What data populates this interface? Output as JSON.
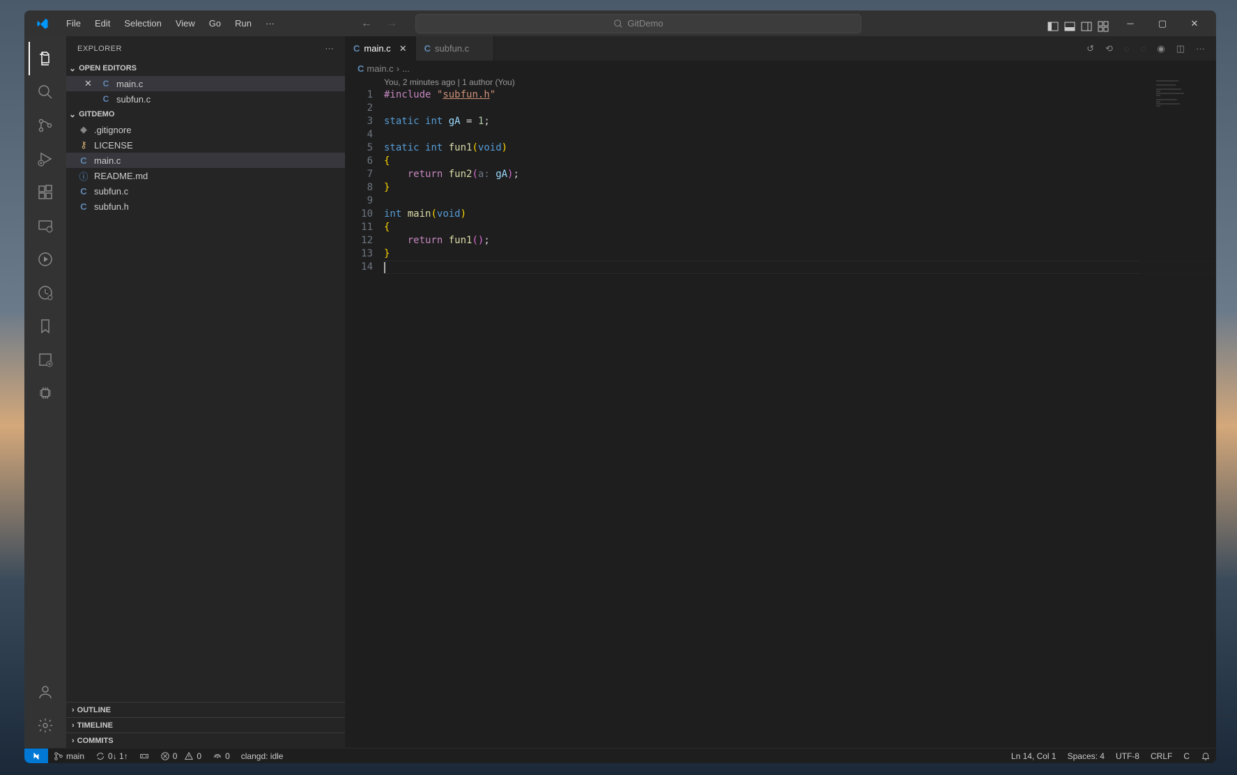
{
  "title_bar": {
    "menu": [
      "File",
      "Edit",
      "Selection",
      "View",
      "Go",
      "Run"
    ],
    "search_placeholder": "GitDemo"
  },
  "activity_bar": {
    "items": [
      "explorer",
      "search",
      "source-control",
      "run-debug",
      "extensions",
      "remote",
      "testing",
      "live-share",
      "bookmarks",
      "cmake",
      "chip"
    ],
    "bottom": [
      "accounts",
      "settings"
    ]
  },
  "sidebar": {
    "title": "EXPLORER",
    "sections": {
      "open_editors": {
        "label": "OPEN EDITORS",
        "items": [
          {
            "name": "main.c",
            "icon": "C",
            "active": true,
            "close": true
          },
          {
            "name": "subfun.c",
            "icon": "C",
            "active": false,
            "close": false
          }
        ]
      },
      "folder": {
        "label": "GITDEMO",
        "items": [
          {
            "name": ".gitignore",
            "icon": "git"
          },
          {
            "name": "LICENSE",
            "icon": "license"
          },
          {
            "name": "main.c",
            "icon": "C",
            "selected": true
          },
          {
            "name": "README.md",
            "icon": "info"
          },
          {
            "name": "subfun.c",
            "icon": "C"
          },
          {
            "name": "subfun.h",
            "icon": "C"
          }
        ]
      },
      "collapsed": [
        "OUTLINE",
        "TIMELINE",
        "COMMITS"
      ]
    }
  },
  "editor": {
    "tabs": [
      {
        "name": "main.c",
        "icon": "C",
        "active": true
      },
      {
        "name": "subfun.c",
        "icon": "C",
        "active": false
      }
    ],
    "breadcrumb": {
      "file": "main.c",
      "sep": "›",
      "rest": "..."
    },
    "codelens": "You, 2 minutes ago | 1 author (You)",
    "lines": [
      {
        "n": 1,
        "html": "<span class='kw-pp'>#include</span> <span class='str'>\"</span><span class='str-u'>subfun.h</span><span class='str'>\"</span>"
      },
      {
        "n": 2,
        "html": ""
      },
      {
        "n": 3,
        "html": "<span class='kw'>static</span> <span class='type'>int</span> <span class='var'>gA</span> <span class='punc'>=</span> <span class='num'>1</span><span class='punc'>;</span>"
      },
      {
        "n": 4,
        "html": ""
      },
      {
        "n": 5,
        "html": "<span class='kw'>static</span> <span class='type'>int</span> <span class='fn'>fun1</span><span class='brace'>(</span><span class='type'>void</span><span class='brace'>)</span>"
      },
      {
        "n": 6,
        "html": "<span class='brace'>{</span>"
      },
      {
        "n": 7,
        "html": "    <span class='kw-pp'>return</span> <span class='fn'>fun2</span><span class='brace2'>(</span><span class='param-hint'>a:</span> <span class='var'>gA</span><span class='brace2'>)</span><span class='punc'>;</span>"
      },
      {
        "n": 8,
        "html": "<span class='brace'>}</span>"
      },
      {
        "n": 9,
        "html": ""
      },
      {
        "n": 10,
        "html": "<span class='type'>int</span> <span class='fn'>main</span><span class='brace'>(</span><span class='type'>void</span><span class='brace'>)</span>"
      },
      {
        "n": 11,
        "html": "<span class='brace'>{</span>"
      },
      {
        "n": 12,
        "html": "    <span class='kw-pp'>return</span> <span class='fn'>fun1</span><span class='brace2'>()</span><span class='punc'>;</span>"
      },
      {
        "n": 13,
        "html": "<span class='brace'>}</span>"
      },
      {
        "n": 14,
        "html": "<span class='cursor-l'></span>"
      }
    ]
  },
  "status_bar": {
    "left": [
      {
        "id": "branch",
        "text": "main"
      },
      {
        "id": "sync",
        "text": "0↓ 1↑"
      },
      {
        "id": "ports",
        "icon": "ports"
      },
      {
        "id": "errors",
        "text": "0"
      },
      {
        "id": "warnings",
        "text": "0"
      },
      {
        "id": "radio",
        "text": "0"
      },
      {
        "id": "clangd",
        "text": "clangd: idle"
      }
    ],
    "right": [
      {
        "id": "pos",
        "text": "Ln 14, Col 1"
      },
      {
        "id": "spaces",
        "text": "Spaces: 4"
      },
      {
        "id": "encoding",
        "text": "UTF-8"
      },
      {
        "id": "eol",
        "text": "CRLF"
      },
      {
        "id": "lang",
        "text": "C"
      },
      {
        "id": "bell",
        "text": ""
      }
    ]
  }
}
